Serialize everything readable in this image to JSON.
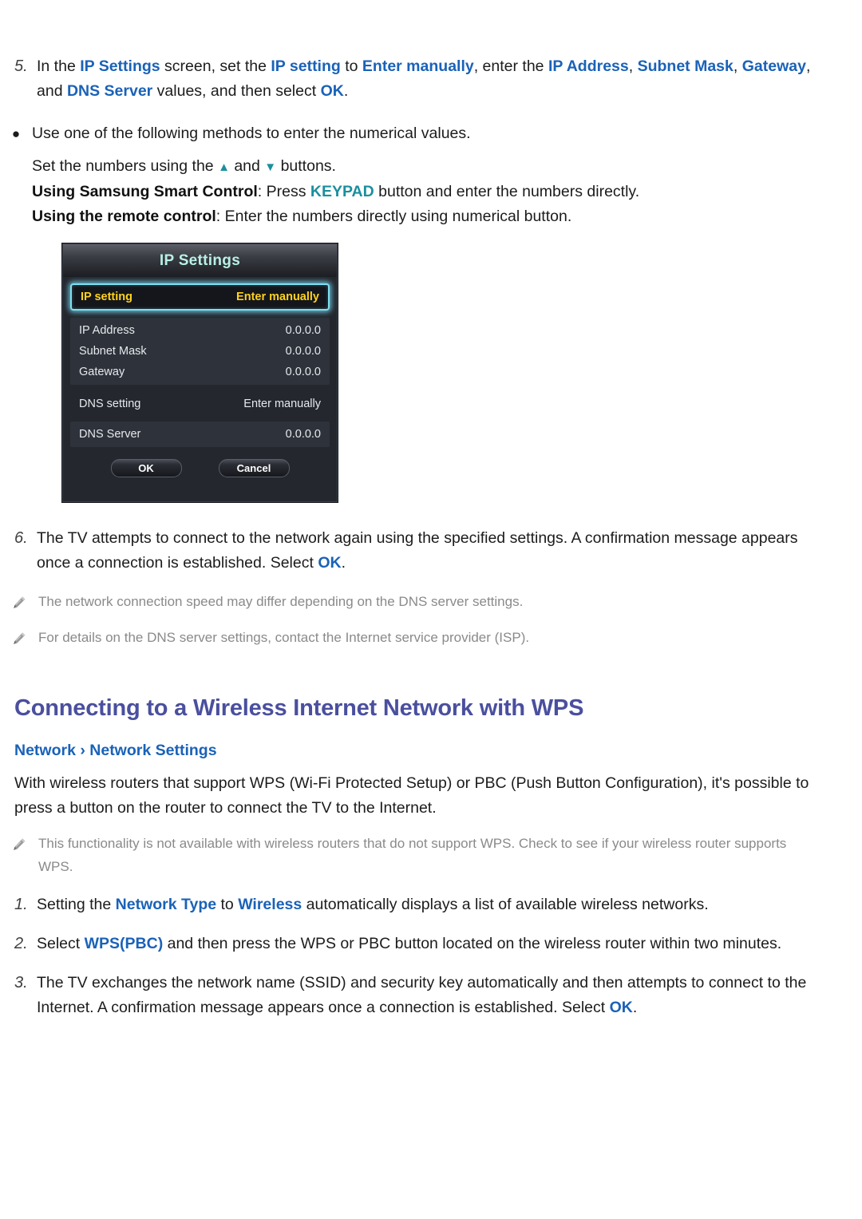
{
  "step5": {
    "number": "5.",
    "text_parts": [
      {
        "t": "In the ",
        "s": "n"
      },
      {
        "t": "IP Settings",
        "s": "b"
      },
      {
        "t": " screen, set the ",
        "s": "n"
      },
      {
        "t": "IP setting",
        "s": "b"
      },
      {
        "t": " to ",
        "s": "n"
      },
      {
        "t": "Enter manually",
        "s": "b"
      },
      {
        "t": ", enter the ",
        "s": "n"
      },
      {
        "t": "IP Address",
        "s": "b"
      },
      {
        "t": ", ",
        "s": "n"
      },
      {
        "t": "Subnet Mask",
        "s": "b"
      },
      {
        "t": ", ",
        "s": "n"
      },
      {
        "t": "Gateway",
        "s": "b"
      },
      {
        "t": ", and ",
        "s": "n"
      },
      {
        "t": "DNS Server",
        "s": "b"
      },
      {
        "t": " values, and then select ",
        "s": "n"
      },
      {
        "t": "OK",
        "s": "b"
      },
      {
        "t": ".",
        "s": "n"
      }
    ]
  },
  "bullet": {
    "marker": "●",
    "text": "Use one of the following methods to enter the numerical values."
  },
  "sub_lines": {
    "line1_prefix": "Set the numbers using the ",
    "up_arrow": "▲",
    "line1_mid": " and ",
    "down_arrow": "▼",
    "line1_suffix": " buttons.",
    "line2_label": "Using Samsung Smart Control",
    "line2_a": ": Press ",
    "line2_key": "KEYPAD",
    "line2_b": " button and enter the numbers directly.",
    "line3_label": "Using the remote control",
    "line3_a": ": Enter the numbers directly using numerical button."
  },
  "tv_dialog": {
    "title": "IP Settings",
    "selected_row": {
      "label": "IP setting",
      "value": "Enter manually"
    },
    "group_rows": [
      {
        "label": "IP Address",
        "value": "0.0.0.0"
      },
      {
        "label": "Subnet Mask",
        "value": "0.0.0.0"
      },
      {
        "label": "Gateway",
        "value": "0.0.0.0"
      }
    ],
    "dns_setting": {
      "label": "DNS setting",
      "value": "Enter manually"
    },
    "dns_server": {
      "label": "DNS Server",
      "value": "0.0.0.0"
    },
    "ok_button": "OK",
    "cancel_button": "Cancel",
    "colors": {
      "highlight_border": "#7fdff0",
      "highlight_text": "#ffd21e",
      "title_text": "#b9f0e4",
      "panel_bg": "#24272e"
    }
  },
  "step6": {
    "number": "6.",
    "text_a": "The TV attempts to connect to the network again using the specified settings. A confirmation message appears once a connection is established. Select ",
    "ok": "OK",
    "text_b": "."
  },
  "notes_after_step6": [
    {
      "icon": "pencil-icon",
      "text": "The network connection speed may differ depending on the DNS server settings."
    },
    {
      "icon": "pencil-icon",
      "text": "For details on the DNS server settings, contact the Internet service provider (ISP)."
    }
  ],
  "section": {
    "title": "Connecting to a Wireless Internet Network with WPS",
    "breadcrumb": "Network › Network Settings",
    "intro": "With wireless routers that support WPS (Wi-Fi Protected Setup) or PBC (Push Button Configuration), it's possible to press a button on the router to connect the TV to the Internet."
  },
  "note_wps": {
    "icon": "pencil-icon",
    "text": "This functionality is not available with wireless routers that do not support WPS. Check to see if your wireless router supports WPS."
  },
  "wps_steps": {
    "step1": {
      "number": "1.",
      "a": "Setting the ",
      "network_type": "Network Type",
      "b": " to ",
      "wireless": "Wireless",
      "c": " automatically displays a list of available wireless networks."
    },
    "step2": {
      "number": "2.",
      "a": "Select ",
      "wpspbc": "WPS(PBC)",
      "b": " and then press the WPS or PBC button located on the wireless router within two minutes."
    },
    "step3": {
      "number": "3.",
      "a": "The TV exchanges the network name (SSID) and security key automatically and then attempts to connect to the Internet. A confirmation message appears once a connection is established. Select ",
      "ok": "OK",
      "b": "."
    }
  },
  "colors": {
    "link_blue": "#1a62b8",
    "teal": "#1b8f9e",
    "heading_purple": "#4a4f9e",
    "note_gray": "#8a8a8a"
  }
}
